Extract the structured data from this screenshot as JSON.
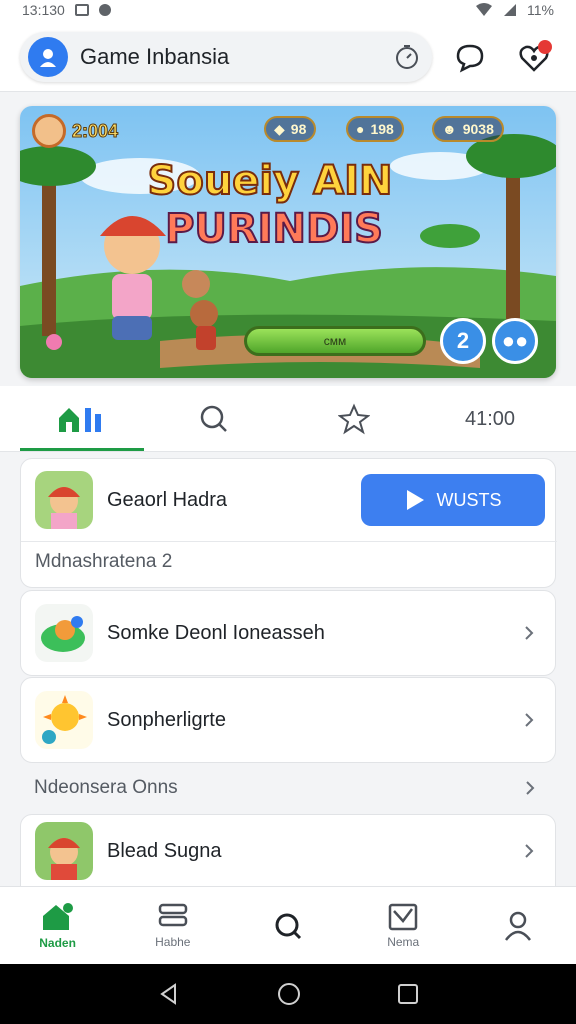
{
  "status_bar": {
    "time": "13:130",
    "battery": "11%"
  },
  "header": {
    "app_title": "Game Inbansia"
  },
  "banner": {
    "title_line1": "Soueiy AIN",
    "title_line2": "PURINDIS",
    "coins": "2:004",
    "gems": "98",
    "stars": "198",
    "friends": "9038",
    "play_label": "ᴄᴍᴍ",
    "level_badge": "2"
  },
  "tabs": {
    "time_label": "41:00"
  },
  "featured": {
    "title": "Geaorl Hadra",
    "cta_label": "WUSTS",
    "subtitle": "Mdnashratena 2"
  },
  "list": [
    {
      "title": "Somke Deonl Ioneasseh"
    },
    {
      "title": "Sonpherligrte"
    }
  ],
  "section": {
    "label": "Ndeonsera Onns"
  },
  "list_bottom": {
    "title": "Blead Sugna"
  },
  "bottom_nav": [
    {
      "label": "Naden",
      "active": true
    },
    {
      "label": "Habhe"
    },
    {
      "label": ""
    },
    {
      "label": "Nema"
    },
    {
      "label": ""
    }
  ],
  "colors": {
    "accent_green": "#1e9b45",
    "accent_blue": "#3d7ff0"
  }
}
